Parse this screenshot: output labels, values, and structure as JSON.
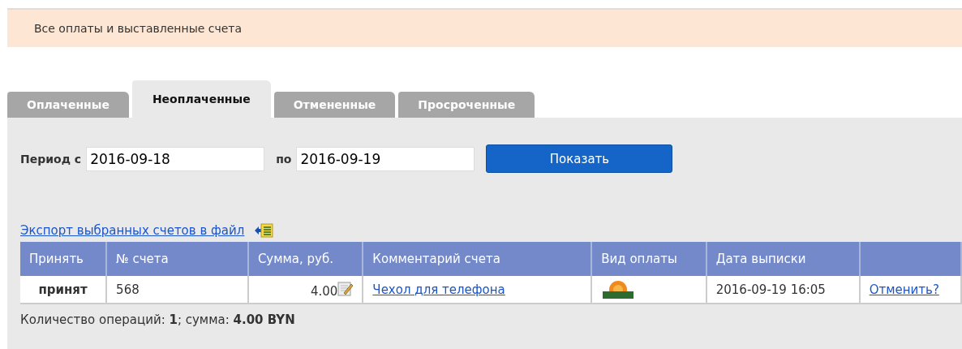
{
  "header": {
    "title": "Все оплаты и выставленные счета"
  },
  "tabs": [
    {
      "label": "Оплаченные",
      "selected": false
    },
    {
      "label": "Неоплаченные",
      "selected": true
    },
    {
      "label": "Отмененные",
      "selected": false
    },
    {
      "label": "Просроченные",
      "selected": false
    }
  ],
  "filter": {
    "from_label": "Период с",
    "from_value": "2016-09-18",
    "to_label": "по",
    "to_value": "2016-09-19",
    "button": "Показать"
  },
  "export_link": "Экспорт выбранных счетов в файл",
  "table": {
    "columns": [
      "Принять",
      "№ счета",
      "Сумма, руб.",
      "Комментарий счета",
      "Вид оплаты",
      "Дата выписки",
      ""
    ],
    "rows": [
      {
        "status": "принят",
        "number": "568",
        "amount": "4.00",
        "comment": "Чехол для телефона",
        "date": "2016-09-19 16:05",
        "action": "Отменить?"
      }
    ]
  },
  "summary": "Количество операций: **1**; сумма: **4.00 BYN**"
}
